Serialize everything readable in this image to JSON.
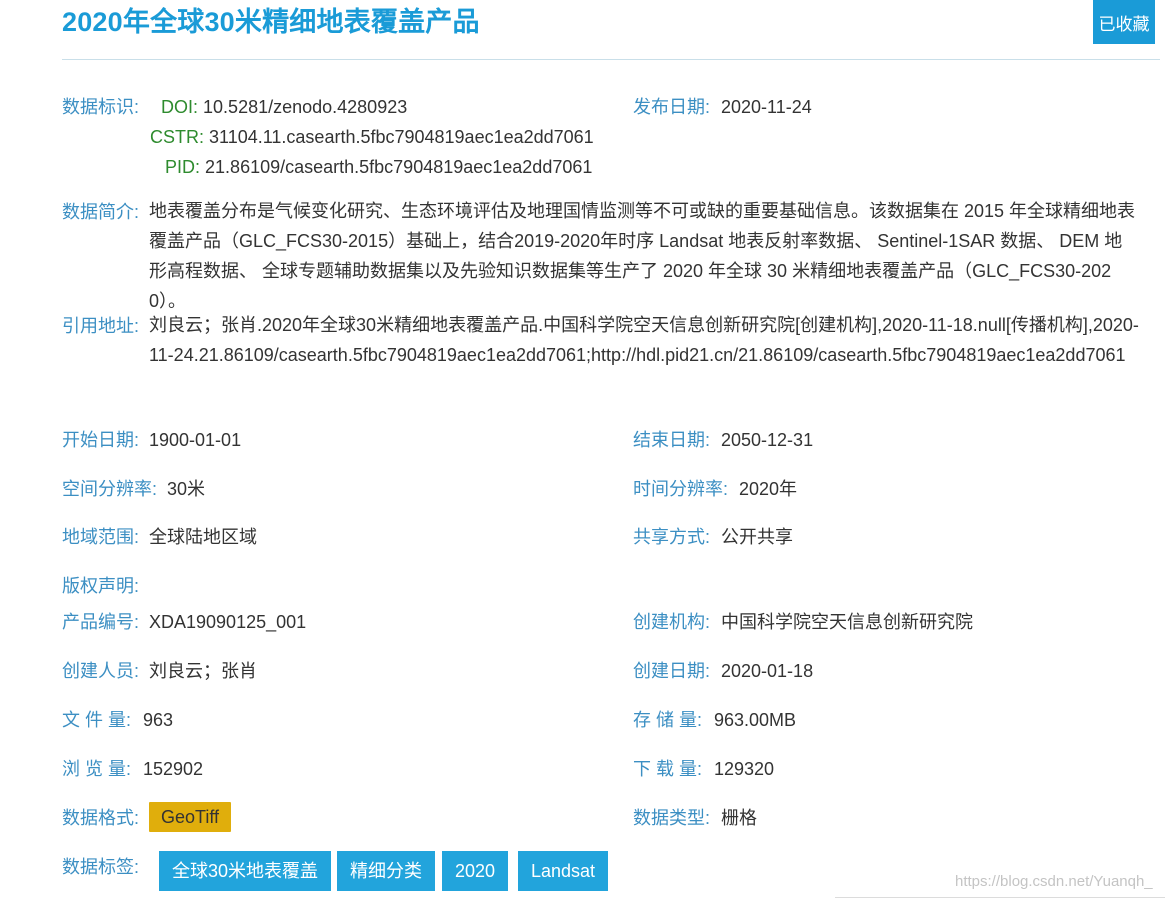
{
  "page": {
    "title": "2020年全球30米精细地表覆盖产品",
    "collect_label": "已收藏"
  },
  "identifiers": {
    "label": "数据标识:",
    "doi_key": "DOI:",
    "doi_value": "10.5281/zenodo.4280923",
    "cstr_key": "CSTR:",
    "cstr_value": "31104.11.casearth.5fbc7904819aec1ea2dd7061",
    "pid_key": "PID:",
    "pid_value": "21.86109/casearth.5fbc7904819aec1ea2dd7061"
  },
  "publish_date": {
    "label": "发布日期:",
    "value": "2020-11-24"
  },
  "summary": {
    "label": "数据简介:",
    "text": "地表覆盖分布是气候变化研究、生态环境评估及地理国情监测等不可或缺的重要基础信息。该数据集在 2015 年全球精细地表覆盖产品（GLC_FCS30-2015）基础上，结合2019-2020年时序 Landsat 地表反射率数据、 Sentinel-1SAR 数据、 DEM 地形高程数据、 全球专题辅助数据集以及先验知识数据集等生产了 2020 年全球 30 米精细地表覆盖产品（GLC_FCS30-2020）。"
  },
  "citation": {
    "label": "引用地址:",
    "text": "刘良云；张肖.2020年全球30米精细地表覆盖产品.中国科学院空天信息创新研究院[创建机构],2020-11-18.null[传播机构],2020-11-24.21.86109/casearth.5fbc7904819aec1ea2dd7061;http://hdl.pid21.cn/21.86109/casearth.5fbc7904819aec1ea2dd7061"
  },
  "fields": {
    "start_date": {
      "label": "开始日期:",
      "value": "1900-01-01"
    },
    "end_date": {
      "label": "结束日期:",
      "value": "2050-12-31"
    },
    "spatial_res": {
      "label": "空间分辨率:",
      "value": "30米"
    },
    "temporal_res": {
      "label": "时间分辨率:",
      "value": "2020年"
    },
    "region": {
      "label": "地域范围:",
      "value": "全球陆地区域"
    },
    "sharing": {
      "label": "共享方式:",
      "value": "公开共享"
    },
    "copyright": {
      "label": "版权声明:",
      "value": ""
    },
    "product_no": {
      "label": "产品编号:",
      "value": "XDA19090125_001"
    },
    "creator_org": {
      "label": "创建机构:",
      "value": "中国科学院空天信息创新研究院"
    },
    "creators": {
      "label": "创建人员:",
      "value": "刘良云；张肖"
    },
    "create_date": {
      "label": "创建日期:",
      "value": "2020-01-18"
    },
    "file_count": {
      "label": "文 件 量:",
      "value": "963"
    },
    "storage": {
      "label": "存 储 量:",
      "value": "963.00MB"
    },
    "views": {
      "label": "浏 览 量:",
      "value": "152902"
    },
    "downloads": {
      "label": "下 载 量:",
      "value": "129320"
    },
    "format": {
      "label": "数据格式:",
      "value": "GeoTiff"
    },
    "data_type": {
      "label": "数据类型:",
      "value": "栅格"
    }
  },
  "tags": {
    "label": "数据标签:",
    "items": [
      "全球30米地表覆盖",
      "精细分类",
      "2020",
      "Landsat"
    ]
  },
  "watermark": "https://blog.csdn.net/Yuanqh_",
  "colors": {
    "accent": "#1a9bd7",
    "label": "#3c8fc3",
    "id_key": "#2e8b2e",
    "format_badge": "#e0ae0c",
    "tag_bg": "#22a4dc"
  }
}
